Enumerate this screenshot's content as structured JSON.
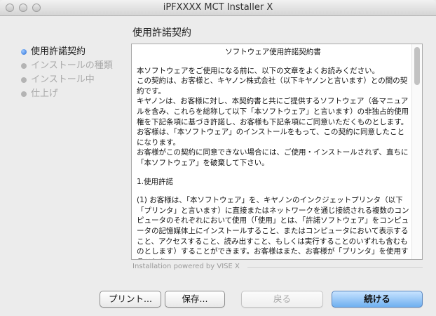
{
  "window": {
    "title": "iPFXXXX MCT Installer X"
  },
  "page": {
    "heading": "使用許諾契約"
  },
  "steps": [
    {
      "label": "使用許諾契約",
      "active": true
    },
    {
      "label": "インストールの種類",
      "active": false
    },
    {
      "label": "インストール中",
      "active": false
    },
    {
      "label": "仕上げ",
      "active": false
    }
  ],
  "license": {
    "title": "ソフトウェア使用許諾契約書",
    "paragraphs": [
      "本ソフトウェアをご使用になる前に、以下の文章をよくお読みください。\nこの契約は、お客様と、キヤノン株式会社（以下キヤノンと言います）との間の契約です。\nキヤノンは、お客様に対し、本契約書と共にご提供するソフトウェア（各マニュアルを含み、これらを総称して以下「本ソフトウェア」と言います）の非独占的使用権を下記条項に基づき許諾し、お客様も下記条項にご同意いただくものとします。\nお客様は、「本ソフトウェア」のインストールをもって、この契約に同意したことになります。\nお客様がこの契約に同意できない場合には、ご使用・インストールされず、直ちに「本ソフトウェア」を破棄して下さい。",
      "1.使用許諾",
      "(1) お客様は、「本ソフトウェア」を、キヤノンのインクジェットプリンタ（以下「プリンタ」と言います）に直接またはネットワークを通じ接続される複数のコンピュータのそれぞれにおいて使用（「使用」とは、「許諾ソフトウェア」をコンピュータの記憶媒体上にインストールすること、またはコンピュータにおいて表示すること、アクセスすること、読み出すこと、もしくは実行することのいずれも含むものとします）することができます。お客様はまた、お客様が「プリンタ」を使用することを"
    ]
  },
  "footer": {
    "powered_by": "Installation powered by VISE X"
  },
  "buttons": {
    "print": "プリント...",
    "save": "保存...",
    "back": "戻る",
    "continue": "続ける"
  }
}
